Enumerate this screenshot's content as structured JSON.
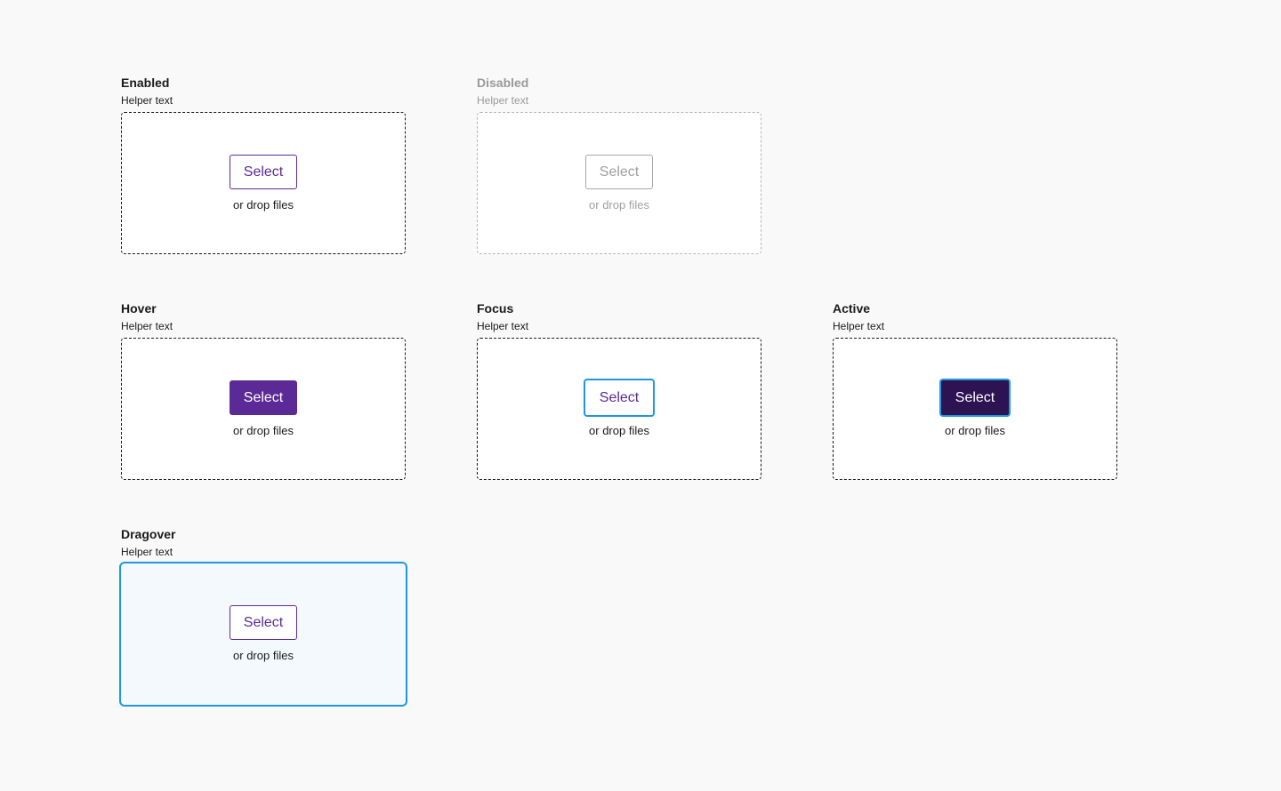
{
  "states": {
    "enabled": {
      "label": "Enabled",
      "helper": "Helper text",
      "button": "Select",
      "drop_text": "or drop files"
    },
    "disabled": {
      "label": "Disabled",
      "helper": "Helper text",
      "button": "Select",
      "drop_text": "or drop files"
    },
    "hover": {
      "label": "Hover",
      "helper": "Helper text",
      "button": "Select",
      "drop_text": "or drop files"
    },
    "focus": {
      "label": "Focus",
      "helper": "Helper text",
      "button": "Select",
      "drop_text": "or drop files"
    },
    "active": {
      "label": "Active",
      "helper": "Helper text",
      "button": "Select",
      "drop_text": "or drop files"
    },
    "dragover": {
      "label": "Dragover",
      "helper": "Helper text",
      "button": "Select",
      "drop_text": "or drop files"
    }
  },
  "colors": {
    "primary": "#5c2a96",
    "primary_dark": "#2d1352",
    "focus_ring": "#2196e0",
    "dragover_bg": "#f4f9fe",
    "disabled": "#a0a0a0",
    "page_bg": "#f9f9f9"
  }
}
